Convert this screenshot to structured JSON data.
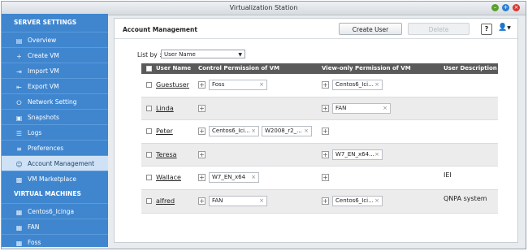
{
  "window": {
    "title": "Virtualization Station"
  },
  "sidebar": {
    "sections": [
      {
        "heading": "SERVER SETTINGS",
        "items": [
          {
            "label": "Overview",
            "icon": "overview-icon"
          },
          {
            "label": "Create VM",
            "icon": "plus-icon"
          },
          {
            "label": "Import VM",
            "icon": "import-icon"
          },
          {
            "label": "Export VM",
            "icon": "export-icon"
          },
          {
            "label": "Network Setting",
            "icon": "network-icon"
          },
          {
            "label": "Snapshots",
            "icon": "snapshot-icon"
          },
          {
            "label": "Logs",
            "icon": "logs-icon"
          },
          {
            "label": "Preferences",
            "icon": "preferences-icon"
          },
          {
            "label": "Account Management",
            "icon": "users-icon",
            "active": true
          },
          {
            "label": "VM Marketplace",
            "icon": "marketplace-icon"
          }
        ]
      },
      {
        "heading": "VIRTUAL MACHINES",
        "items": [
          {
            "label": "Centos6_Icinga",
            "icon": "vm-icon"
          },
          {
            "label": "FAN",
            "icon": "vm-icon"
          },
          {
            "label": "Foss",
            "icon": "vm-icon"
          }
        ]
      }
    ]
  },
  "panel": {
    "title": "Account Management",
    "create_label": "Create User",
    "delete_label": "Delete",
    "help_label": "?",
    "list_by_label": "List by :",
    "list_by_value": "User Name",
    "columns": {
      "user": "User Name",
      "control": "Control Permission of VM",
      "view": "View-only Permission of VM",
      "desc": "User Description"
    },
    "rows": [
      {
        "user": "Guestuser",
        "control": [
          "Foss"
        ],
        "view": [
          "Centos6_Ici..."
        ],
        "desc": ""
      },
      {
        "user": "Linda",
        "control": [],
        "view": [
          "FAN"
        ],
        "desc": ""
      },
      {
        "user": "Peter",
        "control": [
          "Centos6_Ici...",
          "W2008_r2_..."
        ],
        "view": [],
        "desc": ""
      },
      {
        "user": "Teresa",
        "control": [],
        "view": [
          "W7_EN_x64..."
        ],
        "desc": ""
      },
      {
        "user": "Wallace",
        "control": [
          "W7_EN_x64"
        ],
        "view": [],
        "desc": "IEI"
      },
      {
        "user": "alfred",
        "control": [
          "FAN"
        ],
        "view": [
          "Centos6_Ici..."
        ],
        "desc": "QNPA system"
      }
    ]
  }
}
